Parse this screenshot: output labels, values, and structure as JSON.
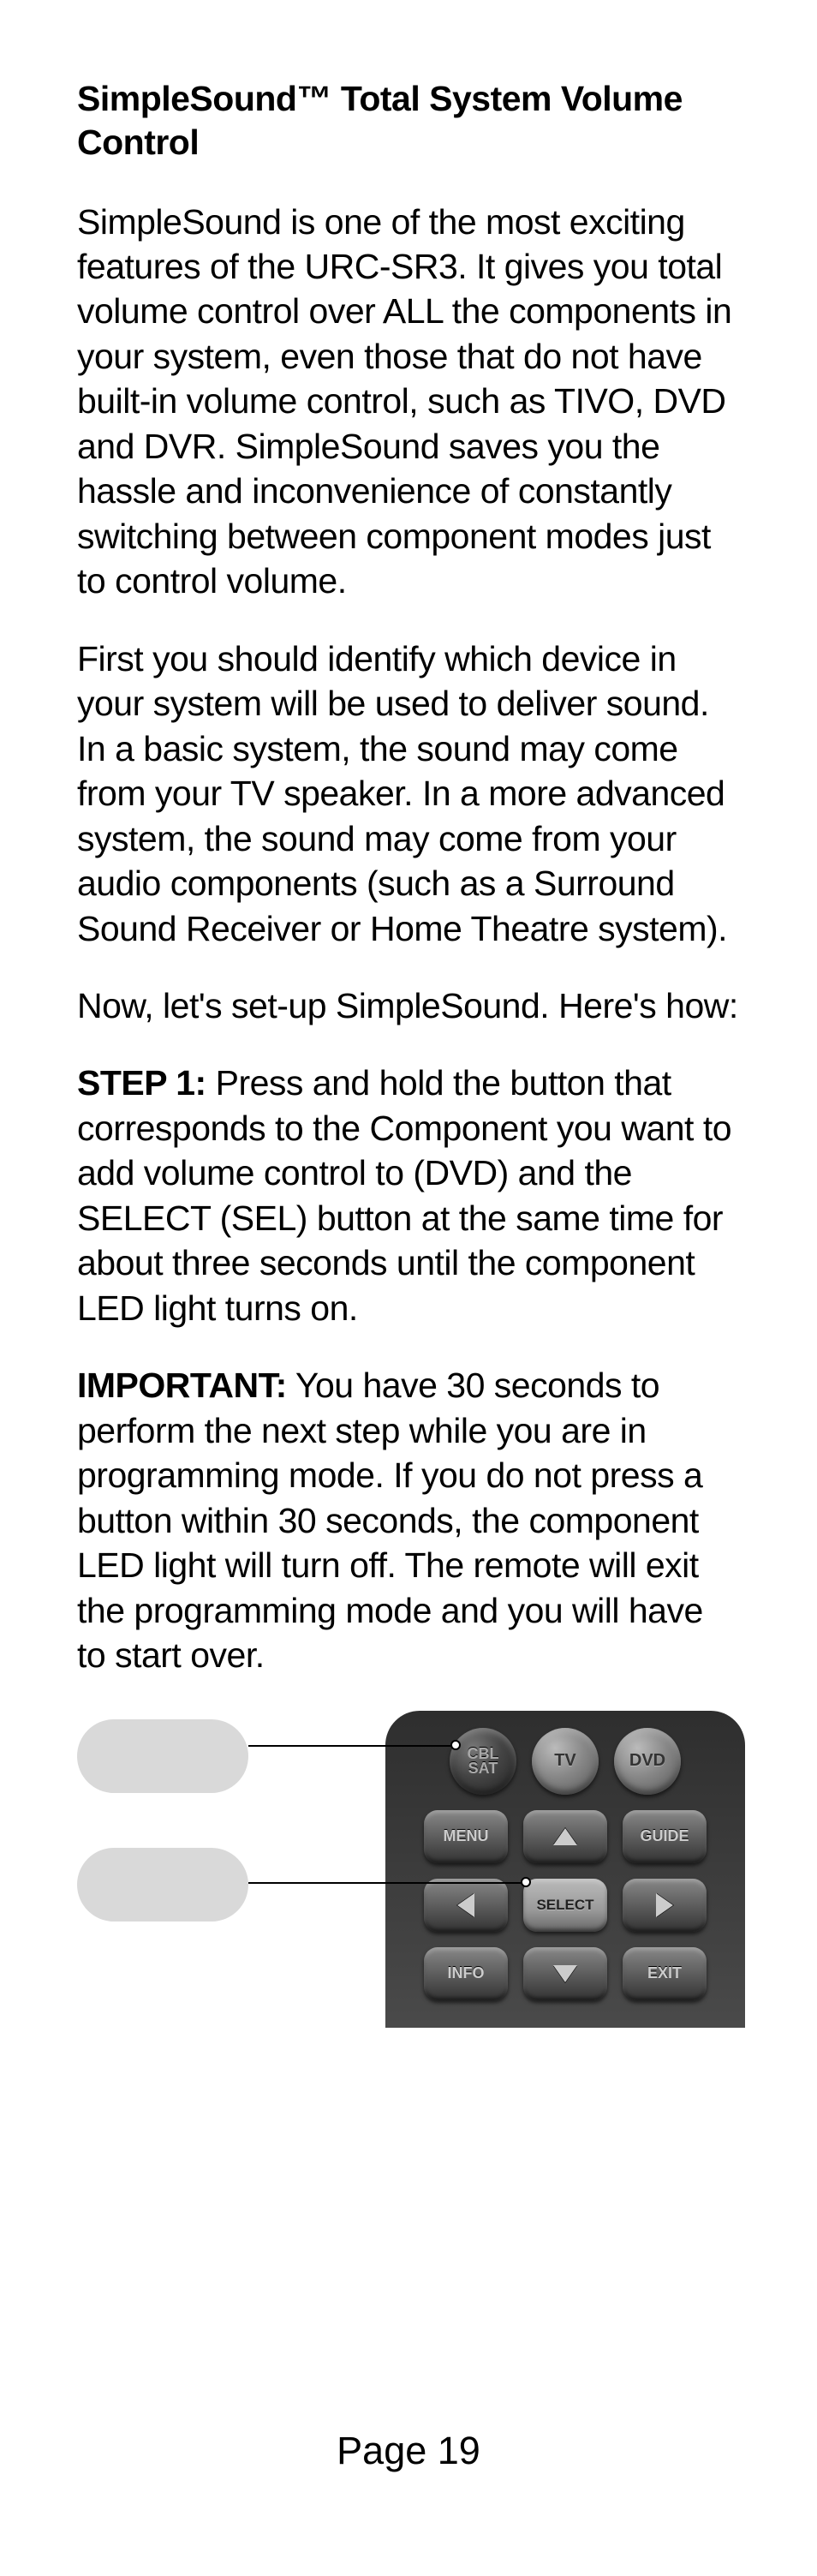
{
  "heading": "SimpleSound™ Total System Volume Control",
  "para1": "SimpleSound is one of the most exciting features of the URC-SR3. It gives you total volume control over ALL the components in your system, even those that do not have built-in volume control, such as TIVO, DVD and DVR. SimpleSound saves you the hassle and inconvenience of constantly switching between component modes just to control volume.",
  "para2": "First you should identify which device in your system will be used to deliver sound. In a basic system, the sound may come from your TV speaker. In a more advanced system, the sound may come from your audio components (such as a Surround Sound Receiver or Home Theatre system).",
  "para3": "Now, let's set-up SimpleSound. Here's how:",
  "step1_label": "STEP 1:",
  "step1_text": " Press and hold the button that corresponds to the Component you want to add volume control to (DVD) and the SELECT (SEL) button at the same time for about three seconds until the component LED light turns on.",
  "important_label": "IMPORTANT:",
  "important_text": " You have 30 seconds to perform the next step while you are in programming mode. If you do not press a button within 30 seconds, the component LED light will turn off. The remote will exit the programming mode and you will have to start over.",
  "remote": {
    "cblsat1": "CBL",
    "cblsat2": "SAT",
    "tv": "TV",
    "dvd": "DVD",
    "menu": "MENU",
    "guide": "GUIDE",
    "select": "SELECT",
    "info": "INFO",
    "exit": "EXIT"
  },
  "footer": "Page 19"
}
